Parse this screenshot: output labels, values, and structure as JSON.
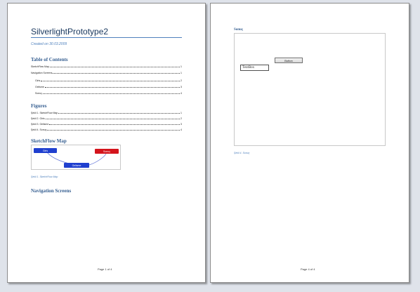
{
  "page1": {
    "title": "SilverlightPrototype2",
    "created": "Created on 30.03.2009",
    "toc": {
      "heading": "Table of Contents",
      "entries": [
        {
          "label": "SketchFlow Map",
          "page": "1"
        },
        {
          "label": "Navigation Screens",
          "page": "1"
        },
        {
          "label": "Giris",
          "page": "2"
        },
        {
          "label": "Gelisme",
          "page": "3"
        },
        {
          "label": "Sonuç",
          "page": "4"
        }
      ]
    },
    "figures": {
      "heading": "Figures",
      "entries": [
        {
          "label": "Şekil 1. SketchFlow Map",
          "page": "1"
        },
        {
          "label": "Şekil 2. Giris",
          "page": "2"
        },
        {
          "label": "Şekil 3. Gelisme",
          "page": "3"
        },
        {
          "label": "Şekil 4. Sonuç",
          "page": "4"
        }
      ]
    },
    "sketchflow": {
      "heading": "SketchFlow Map",
      "nodes": {
        "giris": "Giris",
        "sonuc": "Sonuç",
        "gelisme": "Gelisme"
      },
      "caption": "Şekil 1. SketchFlow Map",
      "colors": {
        "blue_node": "#1f3fcf",
        "red_node": "#d4141c",
        "connector": "#5a6fd6"
      }
    },
    "nav_heading": "Navigation Screens",
    "footer": "Page 1 of 4"
  },
  "page2": {
    "screen_title": "Sonuç",
    "button_label": "Button",
    "textbox_value": "TextBox",
    "caption": "Şekil 4. Sonuç",
    "footer": "Page 4 of 4"
  },
  "colors": {
    "heading": "#365f91",
    "title": "#17365d",
    "accent": "#4f81bd",
    "background": "#dfe3ea"
  }
}
